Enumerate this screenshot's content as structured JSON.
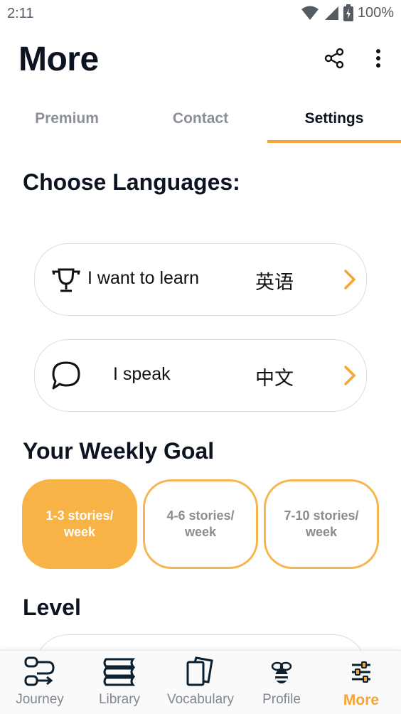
{
  "status": {
    "time": "2:11",
    "battery": "100%"
  },
  "header": {
    "title": "More"
  },
  "tabs": [
    {
      "label": "Premium",
      "active": false
    },
    {
      "label": "Contact",
      "active": false
    },
    {
      "label": "Settings",
      "active": true
    }
  ],
  "languages": {
    "title": "Choose Languages:",
    "learn": {
      "label": "I want to learn",
      "value": "英语",
      "icon": "trophy-icon"
    },
    "speak": {
      "label": "I speak",
      "value": "中文",
      "icon": "speech-bubble-icon"
    }
  },
  "goal": {
    "title": "Your Weekly Goal",
    "options": [
      {
        "label": "1-3 stories/ week",
        "selected": true
      },
      {
        "label": "4-6 stories/ week",
        "selected": false
      },
      {
        "label": "7-10 stories/ week",
        "selected": false
      }
    ]
  },
  "level": {
    "title": "Level"
  },
  "nav": [
    {
      "label": "Journey",
      "icon": "journey-flow-icon"
    },
    {
      "label": "Library",
      "icon": "books-stack-icon"
    },
    {
      "label": "Vocabulary",
      "icon": "cards-icon"
    },
    {
      "label": "Profile",
      "icon": "bee-icon"
    },
    {
      "label": "More",
      "icon": "sliders-icon",
      "active": true
    }
  ],
  "colors": {
    "accent": "#f6a435",
    "goal_selected": "#f8b346",
    "text": "#0b1420",
    "muted": "#8a9096"
  }
}
